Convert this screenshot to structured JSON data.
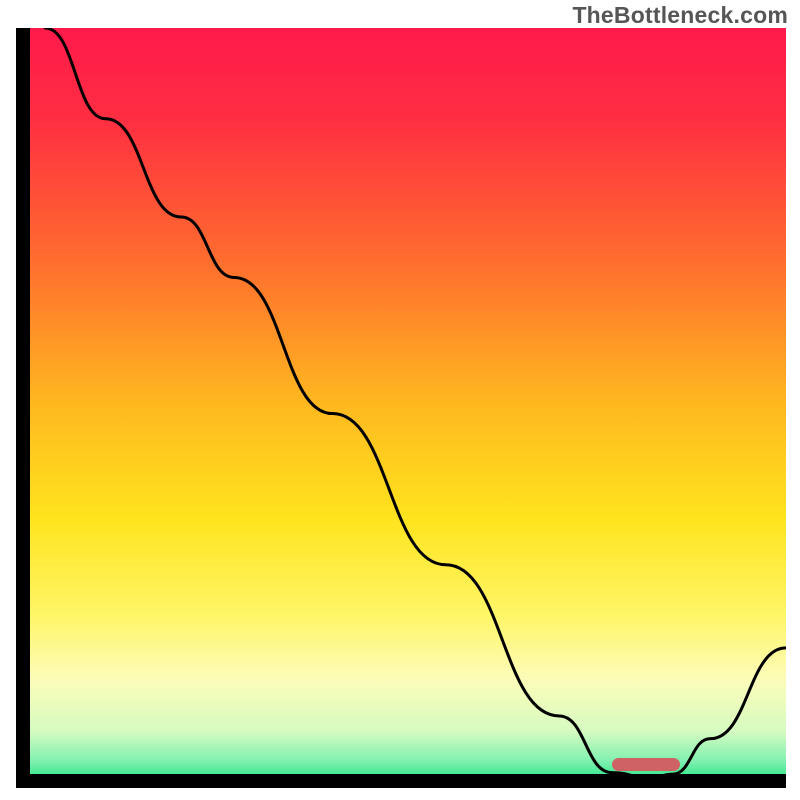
{
  "watermark": "TheBottleneck.com",
  "chart_data": {
    "type": "line",
    "title": "",
    "xlabel": "",
    "ylabel": "",
    "xlim": [
      0,
      100
    ],
    "ylim": [
      0,
      100
    ],
    "x": [
      2,
      10,
      20,
      27,
      40,
      55,
      70,
      77,
      82,
      85,
      90,
      100
    ],
    "y": [
      100,
      88,
      75,
      67,
      49,
      29,
      9,
      1.5,
      0.8,
      1.3,
      6,
      18
    ],
    "gradient_stops": [
      {
        "pct": 0,
        "color": "#ff1a4b"
      },
      {
        "pct": 12,
        "color": "#ff2e42"
      },
      {
        "pct": 30,
        "color": "#ff6a2f"
      },
      {
        "pct": 50,
        "color": "#ffb91f"
      },
      {
        "pct": 65,
        "color": "#ffe41e"
      },
      {
        "pct": 78,
        "color": "#fff66a"
      },
      {
        "pct": 86,
        "color": "#fdfcb8"
      },
      {
        "pct": 93,
        "color": "#d6fbc1"
      },
      {
        "pct": 97,
        "color": "#7ff0b0"
      },
      {
        "pct": 100,
        "color": "#17e57e"
      }
    ],
    "marker": {
      "x_start": 77,
      "x_end": 86,
      "y": 1.2,
      "color": "#cf6363"
    },
    "curve_stroke": "#000000",
    "curve_width": 3
  }
}
